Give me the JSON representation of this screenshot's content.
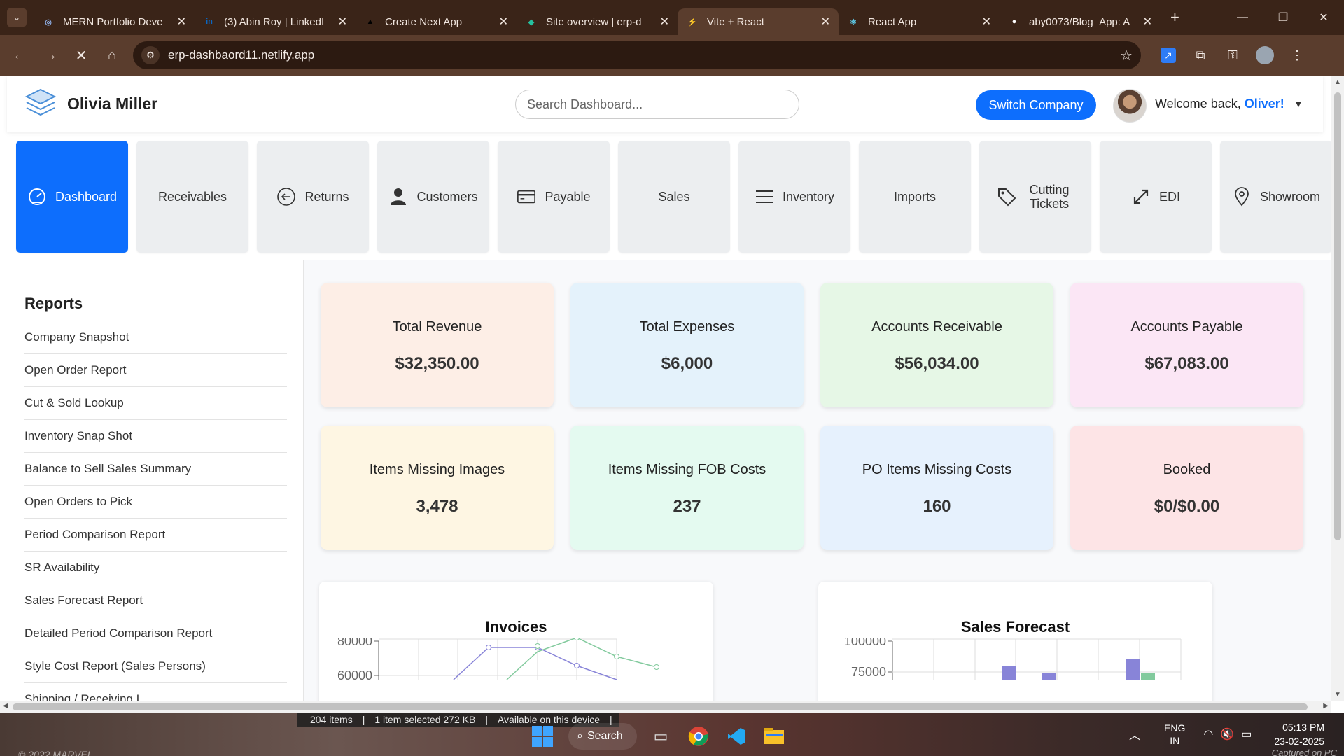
{
  "browser": {
    "tabs": [
      {
        "title": "MERN Portfolio Deve",
        "favicon": "globe-icon",
        "color": "#8fb0e8"
      },
      {
        "title": "(3) Abin Roy | LinkedI",
        "favicon": "linkedin-icon",
        "color": "#0a66c2"
      },
      {
        "title": "Create Next App",
        "favicon": "triangle-icon",
        "color": "#000000"
      },
      {
        "title": "Site overview | erp-d",
        "favicon": "netlify-icon",
        "color": "#25c2a0"
      },
      {
        "title": "Vite + React",
        "favicon": "vite-icon",
        "color": "#bd34fe"
      },
      {
        "title": "React App",
        "favicon": "react-icon",
        "color": "#61dafb"
      },
      {
        "title": "aby0073/Blog_App: A",
        "favicon": "github-icon",
        "color": "#ffffff"
      }
    ],
    "active_tab": 4,
    "url": "erp-dashbaord11.netlify.app"
  },
  "header": {
    "brand": "Olivia Miller",
    "search_placeholder": "Search Dashboard...",
    "switch_label": "Switch Company",
    "welcome_prefix": "Welcome back, ",
    "welcome_name": "Oliver!",
    "caret": "▼"
  },
  "nav": [
    {
      "label": "Dashboard",
      "icon": "speedometer-icon"
    },
    {
      "label": "Receivables",
      "icon": ""
    },
    {
      "label": "Returns",
      "icon": "arrow-left-circle-icon"
    },
    {
      "label": "Customers",
      "icon": "person-icon"
    },
    {
      "label": "Payable",
      "icon": "credit-card-icon"
    },
    {
      "label": "Sales",
      "icon": ""
    },
    {
      "label": "Inventory",
      "icon": "list-icon"
    },
    {
      "label": "Imports",
      "icon": ""
    },
    {
      "label": "Cutting Tickets",
      "icon": "tag-icon"
    },
    {
      "label": "EDI",
      "icon": "arrows-diagonal-icon"
    },
    {
      "label": "Showroom",
      "icon": "location-pin-icon"
    }
  ],
  "sidebar": {
    "title": "Reports",
    "items": [
      "Company Snapshot",
      "Open Order Report",
      "Cut & Sold Lookup",
      "Inventory Snap Shot",
      "Balance to Sell Sales Summary",
      "Open Orders to Pick",
      "Period Comparison Report",
      "SR Availability",
      "Sales Forecast Report",
      "Detailed Period Comparison Report",
      "Style Cost Report (Sales Persons)",
      "Shipping / Receiving L..."
    ]
  },
  "stats": [
    {
      "label": "Total Revenue",
      "value": "$32,350.00",
      "bg": "#fdeee6"
    },
    {
      "label": "Total Expenses",
      "value": "$6,000",
      "bg": "#e4f2fb"
    },
    {
      "label": "Accounts Receivable",
      "value": "$56,034.00",
      "bg": "#e6f7e6"
    },
    {
      "label": "Accounts Payable",
      "value": "$67,083.00",
      "bg": "#fbe6f5"
    },
    {
      "label": "Items Missing Images",
      "value": "3,478",
      "bg": "#fef6e3"
    },
    {
      "label": "Items Missing FOB Costs",
      "value": "237",
      "bg": "#e4faf0"
    },
    {
      "label": "PO Items Missing Costs",
      "value": "160",
      "bg": "#e6f1fd"
    },
    {
      "label": "Booked",
      "value": "$0/$0.00",
      "bg": "#fde4e6"
    }
  ],
  "charts": [
    {
      "title": "Invoices",
      "y_ticks": [
        "80000",
        "60000"
      ],
      "series_colors": [
        "#8884d8",
        "#82ca9d"
      ]
    },
    {
      "title": "Sales Forecast",
      "y_ticks": [
        "100000",
        "75000"
      ],
      "series_colors": [
        "#8884d8",
        "#82ca9d"
      ]
    }
  ],
  "taskbar": {
    "file_items": "204 items",
    "file_selected": "1 item selected  272 KB",
    "file_avail": "Available on this device",
    "search_label": "Search",
    "lang_top": "ENG",
    "lang_bottom": "IN",
    "time": "05:13 PM",
    "date": "23-02-2025",
    "wallpaper_text": "© 2022 MARVEL",
    "captured_text": "Captured on PC"
  }
}
